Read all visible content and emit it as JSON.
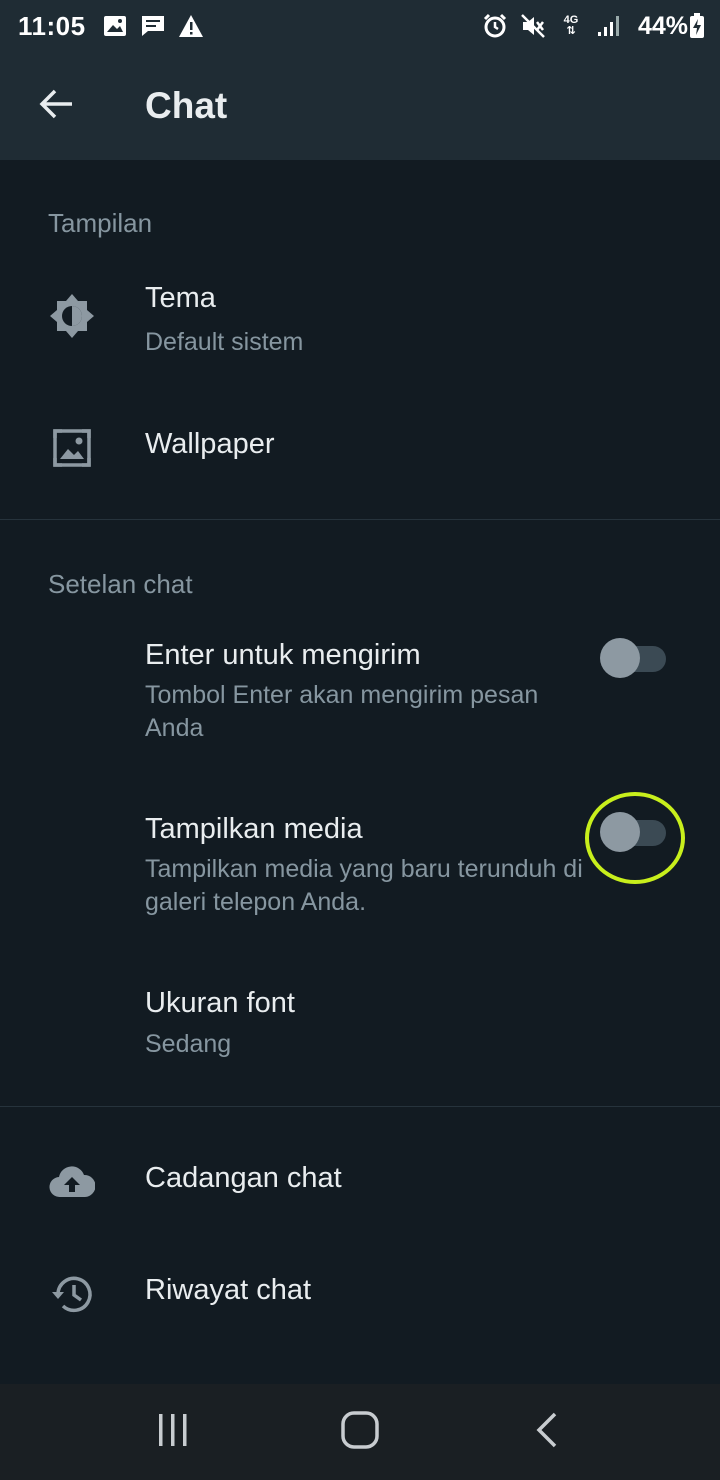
{
  "status_bar": {
    "time": "11:05",
    "battery": "44%",
    "network": "4G",
    "icons": [
      "image-icon",
      "message-icon",
      "warning-icon",
      "alarm-icon",
      "mute-icon",
      "signal-icon",
      "battery-charging-icon"
    ]
  },
  "app_bar": {
    "title": "Chat",
    "back_icon": "arrow-back-icon"
  },
  "sections": {
    "display": {
      "header": "Tampilan",
      "theme": {
        "title": "Tema",
        "subtitle": "Default sistem",
        "icon": "brightness-icon"
      },
      "wallpaper": {
        "title": "Wallpaper",
        "icon": "wallpaper-icon"
      }
    },
    "chat_settings": {
      "header": "Setelan chat",
      "enter_to_send": {
        "title": "Enter untuk mengirim",
        "subtitle": "Tombol Enter akan mengirim pesan Anda",
        "enabled": false
      },
      "media_visibility": {
        "title": "Tampilkan media",
        "subtitle": "Tampilkan media yang baru terunduh di galeri telepon Anda.",
        "enabled": false
      },
      "font_size": {
        "title": "Ukuran font",
        "subtitle": "Sedang"
      }
    },
    "other": {
      "backup": {
        "title": "Cadangan chat",
        "icon": "cloud-upload-icon"
      },
      "history": {
        "title": "Riwayat chat",
        "icon": "history-icon"
      }
    }
  },
  "colors": {
    "background": "#121b22",
    "app_bar": "#1f2c34",
    "primary_text": "#e9edef",
    "secondary_text": "#8696a0",
    "highlight": "#c8ef1c"
  },
  "nav_bar": {
    "icons": [
      "recent-apps-icon",
      "home-icon",
      "back-nav-icon"
    ]
  }
}
